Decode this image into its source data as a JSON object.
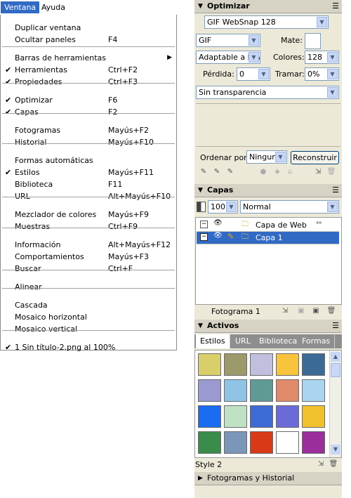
{
  "menubar": {
    "ventana": "Ventana",
    "ayuda": "Ayuda"
  },
  "menu": {
    "items": [
      {
        "label": "Duplicar ventana",
        "shortcut": "",
        "checked": false
      },
      {
        "label": "Ocultar paneles",
        "shortcut": "F4",
        "checked": false
      },
      {
        "label": "Barras de herramientas",
        "shortcut": "",
        "checked": false,
        "submenu": true
      },
      {
        "label": "Herramientas",
        "shortcut": "Ctrl+F2",
        "checked": true
      },
      {
        "label": "Propiedades",
        "shortcut": "Ctrl+F3",
        "checked": true
      },
      {
        "label": "Optimizar",
        "shortcut": "F6",
        "checked": true
      },
      {
        "label": "Capas",
        "shortcut": "F2",
        "checked": true
      },
      {
        "label": "Fotogramas",
        "shortcut": "Mayús+F2",
        "checked": false
      },
      {
        "label": "Historial",
        "shortcut": "Mayús+F10",
        "checked": false
      },
      {
        "label": "Formas automáticas",
        "shortcut": "",
        "checked": false
      },
      {
        "label": "Estilos",
        "shortcut": "Mayús+F11",
        "checked": true
      },
      {
        "label": "Biblioteca",
        "shortcut": "F11",
        "checked": false
      },
      {
        "label": "URL",
        "shortcut": "Alt+Mayús+F10",
        "checked": false
      },
      {
        "label": "Mezclador de colores",
        "shortcut": "Mayús+F9",
        "checked": false
      },
      {
        "label": "Muestras",
        "shortcut": "Ctrl+F9",
        "checked": false
      },
      {
        "label": "Información",
        "shortcut": "Alt+Mayús+F12",
        "checked": false
      },
      {
        "label": "Comportamientos",
        "shortcut": "Mayús+F3",
        "checked": false
      },
      {
        "label": "Buscar",
        "shortcut": "Ctrl+F",
        "checked": false
      },
      {
        "label": "Alinear",
        "shortcut": "",
        "checked": false
      },
      {
        "label": "Cascada",
        "shortcut": "",
        "checked": false
      },
      {
        "label": "Mosaico horizontal",
        "shortcut": "",
        "checked": false
      },
      {
        "label": "Mosaico vertical",
        "shortcut": "",
        "checked": false
      },
      {
        "label": "1 Sin título-2.png al 100%",
        "shortcut": "",
        "checked": true
      }
    ],
    "check_glyph": "✔",
    "submenu_glyph": "▶"
  },
  "optimize": {
    "title": "Optimizar",
    "preset": "GIF WebSnap 128",
    "format": "GIF",
    "mate_label": "Mate:",
    "palette": "Adaptable a la Web",
    "colors_label": "Colores:",
    "colors_value": "128",
    "loss_label": "Pérdida:",
    "loss_value": "0",
    "dither_label": "Tramar:",
    "dither_value": "0%",
    "transparency": "Sin transparencia",
    "sort_label": "Ordenar por:",
    "sort_value": "Ninguno",
    "rebuild_button": "Reconstruir"
  },
  "layers": {
    "title": "Capas",
    "opacity": "100",
    "blend": "Normal",
    "rows": [
      {
        "name": "Capa de Web",
        "selected": false
      },
      {
        "name": "Capa 1",
        "selected": true
      }
    ],
    "frame_label": "Fotograma 1"
  },
  "assets": {
    "title": "Activos",
    "tabs": [
      "Estilos",
      "URL",
      "Biblioteca",
      "Formas"
    ],
    "active_tab": "Estilos",
    "style_name": "Style 2",
    "swatches": [
      "#d9cf6a",
      "#9c9a6a",
      "#c0c0de",
      "#f7c43c",
      "#3c6a96",
      "#9a9ad0",
      "#8fc4e6",
      "#5f9a94",
      "#e08a6a",
      "#a9d6ee",
      "#1a6cf0",
      "#bfe2c4",
      "#3e6ad4",
      "#6a6ad8",
      "#f0c12a",
      "#3a8c4a",
      "#7a96b8",
      "#d83a18",
      "#ffffff",
      "#9a2e9a"
    ]
  },
  "frames_panel": {
    "title": "Fotogramas y Historial"
  }
}
